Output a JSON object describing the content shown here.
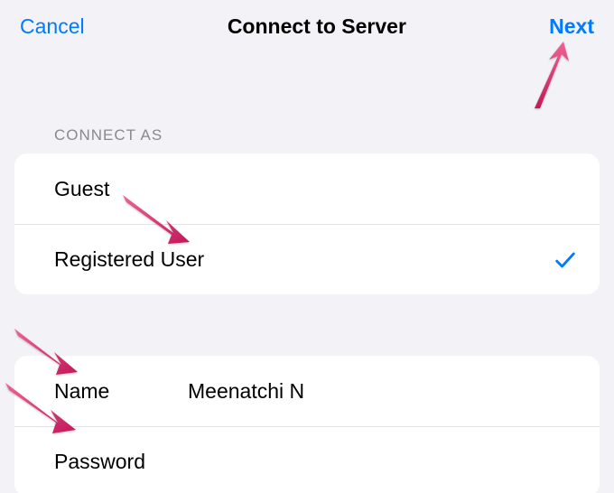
{
  "nav": {
    "cancel": "Cancel",
    "title": "Connect to Server",
    "next": "Next"
  },
  "connect_as": {
    "header": "CONNECT AS",
    "options": {
      "guest": "Guest",
      "registered": "Registered User"
    },
    "selected": "registered"
  },
  "form": {
    "name_label": "Name",
    "name_value": "Meenatchi N",
    "password_label": "Password",
    "password_value": ""
  },
  "colors": {
    "accent": "#007aff",
    "annotation": "#e91e63",
    "background": "#f2f2f7"
  }
}
